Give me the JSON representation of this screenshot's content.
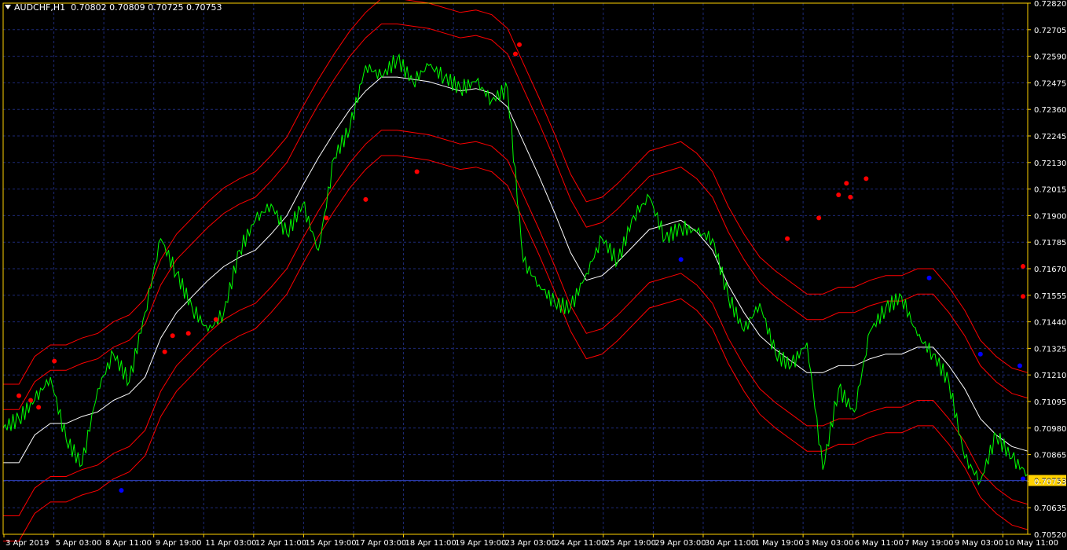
{
  "header": {
    "symbol": "AUDCHF,H1",
    "ohlc": "0.70802 0.70809 0.70725 0.70753"
  },
  "colors": {
    "background": "#000000",
    "frame": "#FFD200",
    "grid": "#1E2A78",
    "price": "#00FF00",
    "middle_band": "#FFFFFF",
    "bands": "#FF0000",
    "dot_upper": "#FF0000",
    "dot_lower": "#0000FF",
    "bid_line": "#2A3AA8",
    "price_tag_bg": "#FFD200",
    "text": "#FFFFFF"
  },
  "chart_data": {
    "type": "line",
    "title": "AUDCHF,H1",
    "y_ticks": [
      "0.72820",
      "0.72705",
      "0.72590",
      "0.72475",
      "0.72360",
      "0.72245",
      "0.72130",
      "0.72015",
      "0.71900",
      "0.71785",
      "0.71670",
      "0.71555",
      "0.71440",
      "0.71325",
      "0.71210",
      "0.71095",
      "0.70980",
      "0.70865",
      "0.70753",
      "0.70635",
      "0.70520"
    ],
    "ylim": [
      0.7052,
      0.7282
    ],
    "current_price": 0.70753,
    "x_labels": [
      "3 Apr 2019",
      "5 Apr 03:00",
      "8 Apr 11:00",
      "9 Apr 19:00",
      "11 Apr 03:00",
      "12 Apr 11:00",
      "15 Apr 19:00",
      "17 Apr 03:00",
      "18 Apr 11:00",
      "19 Apr 19:00",
      "23 Apr 03:00",
      "24 Apr 11:00",
      "25 Apr 19:00",
      "29 Apr 03:00",
      "30 Apr 11:00",
      "1 May 19:00",
      "3 May 03:00",
      "6 May 11:00",
      "7 May 19:00",
      "9 May 03:00",
      "10 May 11:00"
    ],
    "x_index_range": [
      0,
      260
    ],
    "grid": true,
    "series": [
      {
        "role": "price",
        "x": [
          0,
          4,
          8,
          12,
          16,
          20,
          24,
          28,
          32,
          36,
          40,
          44,
          48,
          52,
          56,
          60,
          64,
          68,
          72,
          76,
          80,
          84,
          88,
          92,
          96,
          100,
          104,
          108,
          112,
          116,
          120,
          124,
          128,
          132,
          136,
          140,
          144,
          148,
          152,
          156,
          160,
          164,
          168,
          172,
          176,
          180,
          184,
          188,
          192,
          196,
          200,
          204,
          208,
          212,
          216,
          220,
          224,
          228,
          232,
          236,
          240,
          244,
          248,
          252,
          256,
          260
        ],
        "y": [
          0.7098,
          0.7102,
          0.711,
          0.712,
          0.7093,
          0.7082,
          0.7115,
          0.713,
          0.7118,
          0.7148,
          0.718,
          0.7165,
          0.715,
          0.714,
          0.7148,
          0.7175,
          0.7188,
          0.7195,
          0.7182,
          0.7195,
          0.7175,
          0.7215,
          0.7228,
          0.7255,
          0.725,
          0.7258,
          0.7248,
          0.7255,
          0.725,
          0.7245,
          0.7248,
          0.724,
          0.7245,
          0.717,
          0.716,
          0.7152,
          0.715,
          0.7165,
          0.718,
          0.717,
          0.719,
          0.7198,
          0.718,
          0.7185,
          0.7183,
          0.718,
          0.7155,
          0.714,
          0.7152,
          0.713,
          0.7125,
          0.7135,
          0.708,
          0.7115,
          0.7105,
          0.714,
          0.715,
          0.7155,
          0.7138,
          0.713,
          0.7118,
          0.7085,
          0.7075,
          0.7095,
          0.7085,
          0.7078
        ]
      },
      {
        "role": "middle band",
        "x": [
          0,
          4,
          8,
          12,
          16,
          20,
          24,
          28,
          32,
          36,
          40,
          44,
          48,
          52,
          56,
          60,
          64,
          68,
          72,
          76,
          80,
          84,
          88,
          92,
          96,
          100,
          104,
          108,
          112,
          116,
          120,
          124,
          128,
          132,
          136,
          140,
          144,
          148,
          152,
          156,
          160,
          164,
          168,
          172,
          176,
          180,
          184,
          188,
          192,
          196,
          200,
          204,
          208,
          212,
          216,
          220,
          224,
          228,
          232,
          236,
          240,
          244,
          248,
          252,
          256,
          260
        ],
        "y": [
          0.7083,
          0.7083,
          0.7095,
          0.71,
          0.71,
          0.7103,
          0.7105,
          0.711,
          0.7113,
          0.712,
          0.7137,
          0.7148,
          0.7155,
          0.7162,
          0.7168,
          0.7172,
          0.7175,
          0.7182,
          0.719,
          0.7203,
          0.7215,
          0.7226,
          0.7236,
          0.7244,
          0.725,
          0.725,
          0.7249,
          0.7248,
          0.7246,
          0.7244,
          0.7245,
          0.7243,
          0.7237,
          0.7222,
          0.7207,
          0.7191,
          0.7174,
          0.7162,
          0.7164,
          0.717,
          0.7177,
          0.7184,
          0.7186,
          0.7188,
          0.7183,
          0.7175,
          0.716,
          0.7148,
          0.7138,
          0.7132,
          0.7127,
          0.7122,
          0.7122,
          0.7125,
          0.7125,
          0.7128,
          0.713,
          0.713,
          0.7133,
          0.7133,
          0.7125,
          0.7115,
          0.7102,
          0.7095,
          0.709,
          0.7088
        ]
      },
      {
        "role": "band",
        "x": [
          0,
          4,
          8,
          12,
          16,
          20,
          24,
          28,
          32,
          36,
          40,
          44,
          48,
          52,
          56,
          60,
          64,
          68,
          72,
          76,
          80,
          84,
          88,
          92,
          96,
          100,
          104,
          108,
          112,
          116,
          120,
          124,
          128,
          132,
          136,
          140,
          144,
          148,
          152,
          156,
          160,
          164,
          168,
          172,
          176,
          180,
          184,
          188,
          192,
          196,
          200,
          204,
          208,
          212,
          216,
          220,
          224,
          228,
          232,
          236,
          240,
          244,
          248,
          252,
          256,
          260
        ],
        "y": [
          0.7106,
          0.7106,
          0.7118,
          0.7123,
          0.7123,
          0.7126,
          0.7128,
          0.7133,
          0.7136,
          0.7143,
          0.716,
          0.7171,
          0.7178,
          0.7185,
          0.7191,
          0.7195,
          0.7198,
          0.7205,
          0.7213,
          0.7226,
          0.7238,
          0.7249,
          0.7259,
          0.7267,
          0.7273,
          0.7273,
          0.7272,
          0.7271,
          0.7269,
          0.7267,
          0.7268,
          0.7266,
          0.726,
          0.7245,
          0.723,
          0.7214,
          0.7197,
          0.7185,
          0.7187,
          0.7193,
          0.72,
          0.7207,
          0.7209,
          0.7211,
          0.7206,
          0.7198,
          0.7183,
          0.7171,
          0.7161,
          0.7155,
          0.715,
          0.7145,
          0.7145,
          0.7148,
          0.7148,
          0.7151,
          0.7153,
          0.7153,
          0.7156,
          0.7156,
          0.7148,
          0.7138,
          0.7125,
          0.7118,
          0.7113,
          0.7111
        ]
      },
      {
        "role": "band",
        "x": [
          0,
          4,
          8,
          12,
          16,
          20,
          24,
          28,
          32,
          36,
          40,
          44,
          48,
          52,
          56,
          60,
          64,
          68,
          72,
          76,
          80,
          84,
          88,
          92,
          96,
          100,
          104,
          108,
          112,
          116,
          120,
          124,
          128,
          132,
          136,
          140,
          144,
          148,
          152,
          156,
          160,
          164,
          168,
          172,
          176,
          180,
          184,
          188,
          192,
          196,
          200,
          204,
          208,
          212,
          216,
          220,
          224,
          228,
          232,
          236,
          240,
          244,
          248,
          252,
          256,
          260
        ],
        "y": [
          0.7117,
          0.7117,
          0.7129,
          0.7134,
          0.7134,
          0.7137,
          0.7139,
          0.7144,
          0.7147,
          0.7154,
          0.7171,
          0.7182,
          0.7189,
          0.7196,
          0.7202,
          0.7206,
          0.7209,
          0.7216,
          0.7224,
          0.7237,
          0.7249,
          0.726,
          0.727,
          0.7278,
          0.7284,
          0.7284,
          0.7283,
          0.7282,
          0.728,
          0.7278,
          0.7279,
          0.7277,
          0.7271,
          0.7256,
          0.7241,
          0.7225,
          0.7208,
          0.7196,
          0.7198,
          0.7204,
          0.7211,
          0.7218,
          0.722,
          0.7222,
          0.7217,
          0.7209,
          0.7194,
          0.7182,
          0.7172,
          0.7166,
          0.7161,
          0.7156,
          0.7156,
          0.7159,
          0.7159,
          0.7162,
          0.7164,
          0.7164,
          0.7167,
          0.7167,
          0.7159,
          0.7149,
          0.7136,
          0.7129,
          0.7124,
          0.7122
        ]
      },
      {
        "role": "band",
        "x": [
          0,
          4,
          8,
          12,
          16,
          20,
          24,
          28,
          32,
          36,
          40,
          44,
          48,
          52,
          56,
          60,
          64,
          68,
          72,
          76,
          80,
          84,
          88,
          92,
          96,
          100,
          104,
          108,
          112,
          116,
          120,
          124,
          128,
          132,
          136,
          140,
          144,
          148,
          152,
          156,
          160,
          164,
          168,
          172,
          176,
          180,
          184,
          188,
          192,
          196,
          200,
          204,
          208,
          212,
          216,
          220,
          224,
          228,
          232,
          236,
          240,
          244,
          248,
          252,
          256,
          260
        ],
        "y": [
          0.706,
          0.706,
          0.7072,
          0.7077,
          0.7077,
          0.708,
          0.7082,
          0.7087,
          0.709,
          0.7097,
          0.7114,
          0.7125,
          0.7132,
          0.7139,
          0.7145,
          0.7149,
          0.7152,
          0.7159,
          0.7167,
          0.718,
          0.7192,
          0.7203,
          0.7213,
          0.7221,
          0.7227,
          0.7227,
          0.7226,
          0.7225,
          0.7223,
          0.7221,
          0.7222,
          0.722,
          0.7214,
          0.7199,
          0.7184,
          0.7168,
          0.7151,
          0.7139,
          0.7141,
          0.7147,
          0.7154,
          0.7161,
          0.7163,
          0.7165,
          0.716,
          0.7152,
          0.7137,
          0.7125,
          0.7115,
          0.7109,
          0.7104,
          0.7099,
          0.7099,
          0.7102,
          0.7102,
          0.7105,
          0.7107,
          0.7107,
          0.711,
          0.711,
          0.7102,
          0.7092,
          0.7079,
          0.7072,
          0.7067,
          0.7065
        ]
      },
      {
        "role": "band",
        "x": [
          0,
          4,
          8,
          12,
          16,
          20,
          24,
          28,
          32,
          36,
          40,
          44,
          48,
          52,
          56,
          60,
          64,
          68,
          72,
          76,
          80,
          84,
          88,
          92,
          96,
          100,
          104,
          108,
          112,
          116,
          120,
          124,
          128,
          132,
          136,
          140,
          144,
          148,
          152,
          156,
          160,
          164,
          168,
          172,
          176,
          180,
          184,
          188,
          192,
          196,
          200,
          204,
          208,
          212,
          216,
          220,
          224,
          228,
          232,
          236,
          240,
          244,
          248,
          252,
          256,
          260
        ],
        "y": [
          0.7049,
          0.7049,
          0.7061,
          0.7066,
          0.7066,
          0.7069,
          0.7071,
          0.7076,
          0.7079,
          0.7086,
          0.7103,
          0.7114,
          0.7121,
          0.7128,
          0.7134,
          0.7138,
          0.7141,
          0.7148,
          0.7156,
          0.7169,
          0.7181,
          0.7192,
          0.7202,
          0.721,
          0.7216,
          0.7216,
          0.7215,
          0.7214,
          0.7212,
          0.721,
          0.7211,
          0.7209,
          0.7203,
          0.7188,
          0.7173,
          0.7157,
          0.714,
          0.7128,
          0.713,
          0.7136,
          0.7143,
          0.715,
          0.7152,
          0.7154,
          0.7149,
          0.7141,
          0.7126,
          0.7114,
          0.7104,
          0.7098,
          0.7093,
          0.7088,
          0.7088,
          0.7091,
          0.7091,
          0.7094,
          0.7096,
          0.7096,
          0.7099,
          0.7099,
          0.7091,
          0.7081,
          0.7068,
          0.7061,
          0.7056,
          0.7054
        ]
      }
    ],
    "upper_dots": [
      [
        4,
        0.7112
      ],
      [
        7,
        0.711
      ],
      [
        9,
        0.7107
      ],
      [
        13,
        0.7127
      ],
      [
        41,
        0.7131
      ],
      [
        43,
        0.7138
      ],
      [
        47,
        0.7139
      ],
      [
        54,
        0.7145
      ],
      [
        82,
        0.7189
      ],
      [
        92,
        0.7197
      ],
      [
        105,
        0.7209
      ],
      [
        130,
        0.726
      ],
      [
        131,
        0.7264
      ],
      [
        199,
        0.718
      ],
      [
        207,
        0.7189
      ],
      [
        212,
        0.7199
      ],
      [
        214,
        0.7204
      ],
      [
        215,
        0.7198
      ],
      [
        219,
        0.7206
      ],
      [
        280,
        0.7168
      ],
      [
        290,
        0.7155
      ]
    ],
    "lower_dots": [
      [
        30,
        0.7071
      ],
      [
        172,
        0.7171
      ],
      [
        235,
        0.7163
      ],
      [
        248,
        0.713
      ],
      [
        258,
        0.7125
      ],
      [
        266,
        0.7076
      ]
    ]
  }
}
